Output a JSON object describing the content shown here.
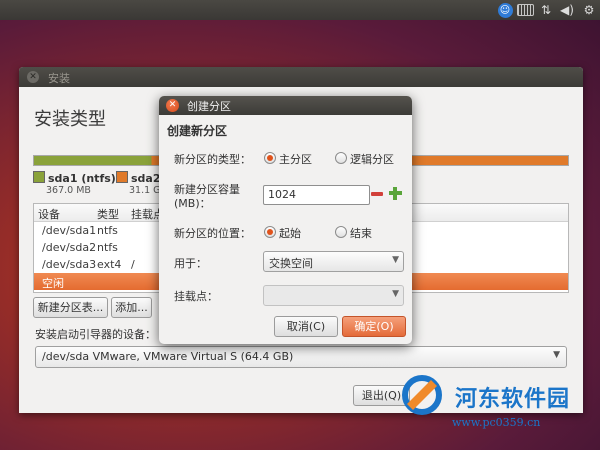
{
  "top_panel": {
    "icons": [
      "accessibility-icon",
      "keyboard-icon",
      "network-icon",
      "volume-icon",
      "gear-icon"
    ]
  },
  "main_window": {
    "title": "安装",
    "close_glyph": "✕",
    "page_title": "安装类型",
    "partitions_bar": [
      {
        "name": "sda1 (ntfs)",
        "size": "367.0 MB",
        "color": "#8aa23a"
      },
      {
        "name": "sda2 (",
        "size": "31.1 G",
        "color": "#e07a2a"
      }
    ],
    "table": {
      "headers": [
        "设备",
        "类型",
        "挂载点"
      ],
      "rows": [
        {
          "device": "/dev/sda1",
          "type": "ntfs",
          "mount": ""
        },
        {
          "device": "/dev/sda2",
          "type": "ntfs",
          "mount": ""
        },
        {
          "device": "/dev/sda3",
          "type": "ext4",
          "mount": "/"
        },
        {
          "device": "空闲",
          "type": "",
          "mount": "",
          "selected": true
        }
      ]
    },
    "buttons": {
      "new_table": "新建分区表...",
      "add": "添加...",
      "quit": "退出(Q)"
    },
    "boot_loader_label": "安装启动引导器的设备：",
    "boot_loader_value": "/dev/sda    VMware, VMware Virtual S (64.4 GB)"
  },
  "dialog": {
    "title": "创建分区",
    "close_glyph": "✕",
    "heading": "创建新分区",
    "type_label": "新分区的类型：",
    "type_options": [
      "主分区",
      "逻辑分区"
    ],
    "type_selected": 0,
    "size_label_1": "新建分区容量",
    "size_label_2": "(MB)：",
    "size_value": "1024",
    "location_label": "新分区的位置：",
    "location_options": [
      "起始",
      "结束"
    ],
    "location_selected": 0,
    "use_label": "用于：",
    "use_value": "交换空间",
    "mount_label": "挂载点：",
    "mount_value": "",
    "cancel": "取消(C)",
    "ok": "确定(O)"
  },
  "watermark": {
    "text": "河东软件园",
    "url": "www.pc0359.cn"
  },
  "colors": {
    "accent": "#e46b30",
    "watermark": "#1b75c9"
  }
}
